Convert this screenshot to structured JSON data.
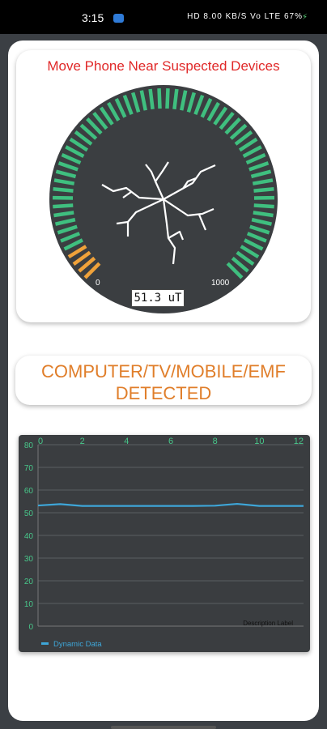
{
  "status_bar": {
    "time": "3:15",
    "right": "HD 8.00 KB/S  Vo LTE  67%"
  },
  "gauge": {
    "title": "Move Phone Near Suspected Devices",
    "value_label": "51.3 uT",
    "min_label": "0",
    "max_label": "1000",
    "level": 0.95,
    "colors": {
      "green": "#3fbf7f",
      "orange": "#f0a23a",
      "face": "#3b3e41",
      "title": "#e02828"
    }
  },
  "detection": {
    "line1": "COMPUTER/TV/MOBILE/EMF",
    "line2": "DETECTED",
    "color": "#e07e2a"
  },
  "chart_data": {
    "type": "line",
    "x_ticks": [
      "0",
      "2",
      "4",
      "6",
      "8",
      "10",
      "12"
    ],
    "y_ticks": [
      "0",
      "10",
      "20",
      "30",
      "40",
      "50",
      "60",
      "70",
      "80"
    ],
    "xlim": [
      0,
      12
    ],
    "ylim": [
      0,
      80
    ],
    "grid": true,
    "description": "Description Label",
    "legend": "Dynamic Data",
    "series": [
      {
        "name": "Dynamic Data",
        "color": "#3ea6d8",
        "x": [
          0,
          1,
          2,
          3,
          4,
          5,
          6,
          7,
          8,
          9,
          10,
          11,
          12
        ],
        "y": [
          53.2,
          53.8,
          53.0,
          53.0,
          53.0,
          53.0,
          53.0,
          53.0,
          53.1,
          53.9,
          53.0,
          53.0,
          53.0
        ]
      }
    ]
  }
}
